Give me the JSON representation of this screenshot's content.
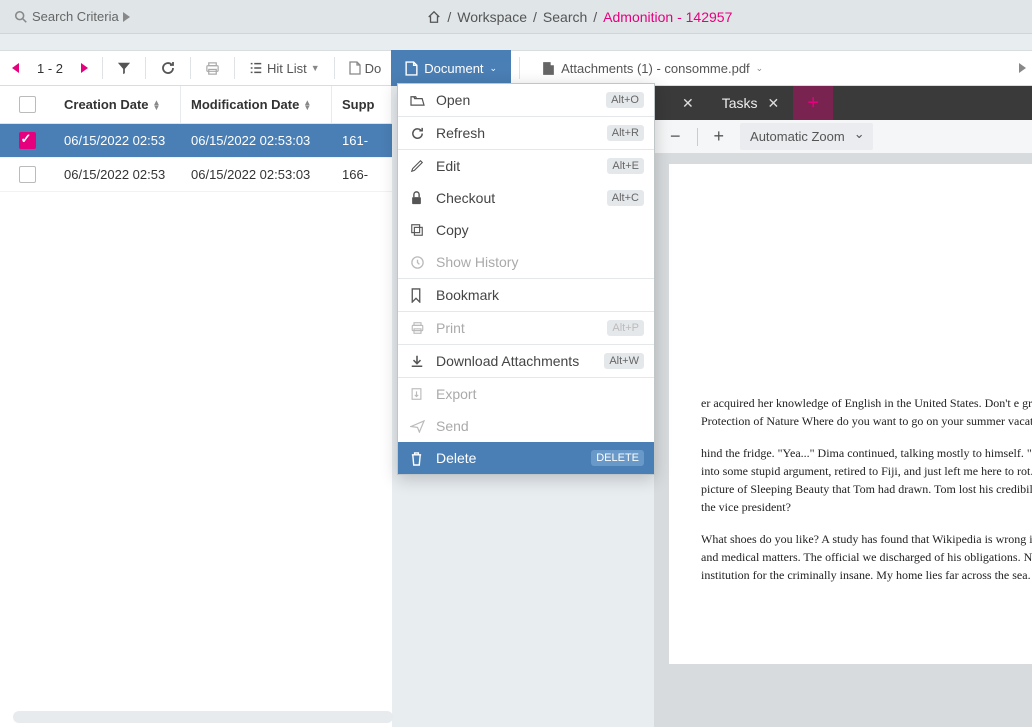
{
  "searchCriteria": "Search Criteria",
  "breadcrumb": {
    "parts": [
      "Workspace",
      "Search"
    ],
    "current": "Admonition - 142957"
  },
  "pager": "1 - 2",
  "hitlist": "Hit List",
  "docPartial": "Do",
  "docBtn": "Document",
  "attachBtn": "Attachments (1) - consomme.pdf",
  "cols": {
    "create": "Creation Date",
    "mod": "Modification Date",
    "supp": "Supp"
  },
  "rows": [
    {
      "sel": true,
      "create": "06/15/2022 02:53",
      "mod": "06/15/2022 02:53:03",
      "supp": "161-"
    },
    {
      "sel": false,
      "create": "06/15/2022 02:53",
      "mod": "06/15/2022 02:53:03",
      "supp": "166-"
    }
  ],
  "menu": {
    "open": "Open",
    "openKey": "Alt+O",
    "refresh": "Refresh",
    "refreshKey": "Alt+R",
    "edit": "Edit",
    "editKey": "Alt+E",
    "checkout": "Checkout",
    "checkoutKey": "Alt+C",
    "copy": "Copy",
    "history": "Show History",
    "bookmark": "Bookmark",
    "print": "Print",
    "printKey": "Alt+P",
    "download": "Download Attachments",
    "downloadKey": "Alt+W",
    "export": "Export",
    "send": "Send",
    "delete": "Delete",
    "deleteKey": "DELETE"
  },
  "tabs": {
    "tasks": "Tasks"
  },
  "zoom": "Automatic Zoom",
  "doc": {
    "p1": "er acquired her knowledge of English in the United States. Don't e greatest positive integer. The Society for Protection of Nature Where do you want to go on your summer vacation? The ge fire.",
    "p2": "hind the fridge. \"Yea...\" Dima continued, talking mostly to himself. \"It's as if the author of my story got into some stupid argument, retired to Fiji, and just left me here to rot.\" Mary could not turn away from the picture of Sleeping Beauty that Tom had drawn. Tom lost his credibility. Can you arrange a meeting with the vice president?",
    "p3": "What shoes do you like? A study has found that Wikipedia is wrong in 90 percent of its entries on health and medical matters. The official we discharged of his obligations. Nothing has changed. This is an institution for the criminally insane. My home lies far across the sea."
  }
}
